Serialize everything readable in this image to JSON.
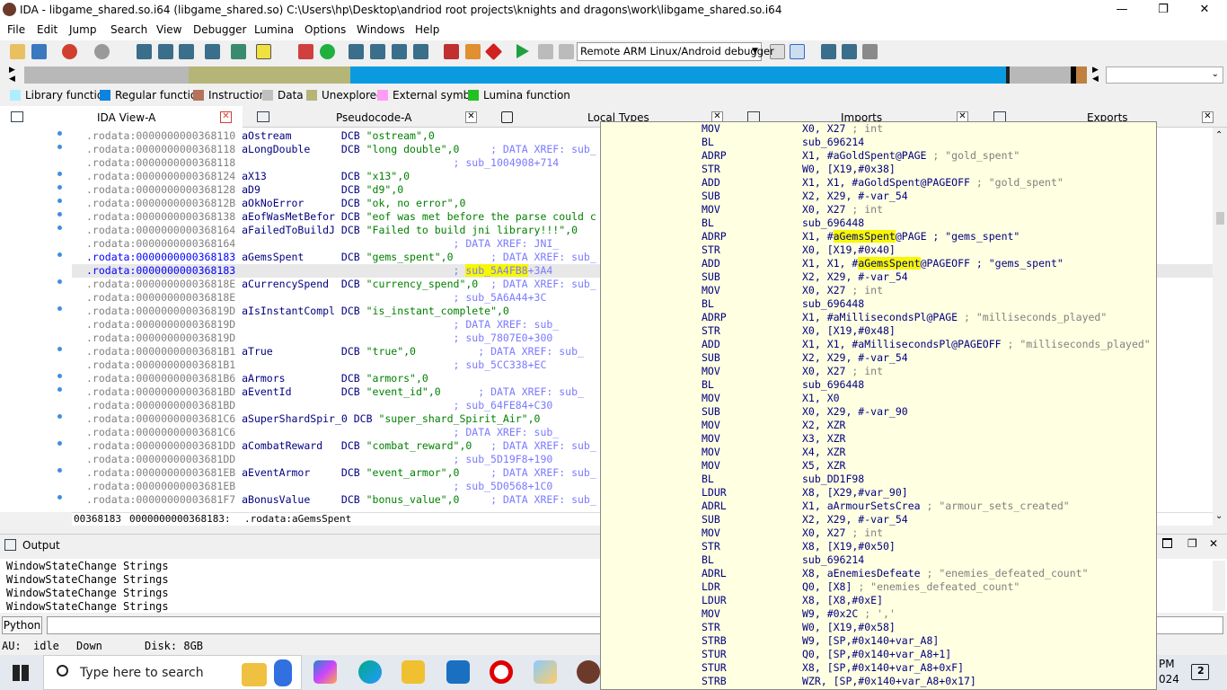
{
  "window": {
    "title": "IDA - libgame_shared.so.i64 (libgame_shared.so) C:\\Users\\hp\\Desktop\\andriod root projects\\knights and dragons\\work\\libgame_shared.so.i64",
    "minimize": "—",
    "restore": "❐",
    "close": "✕"
  },
  "menu": [
    "File",
    "Edit",
    "Jump",
    "Search",
    "View",
    "Debugger",
    "Lumina",
    "Options",
    "Windows",
    "Help"
  ],
  "toolbar": {
    "debugger_select": "Remote ARM Linux/Android debugger"
  },
  "legend": [
    {
      "label": "Library function",
      "color": "#aeeeff"
    },
    {
      "label": "Regular function",
      "color": "#0a84e0"
    },
    {
      "label": "Instruction",
      "color": "#b5735a"
    },
    {
      "label": "Data",
      "color": "#c0c0c0"
    },
    {
      "label": "Unexplored",
      "color": "#b5b578"
    },
    {
      "label": "External symbol",
      "color": "#ff9cf6"
    },
    {
      "label": "Lumina function",
      "color": "#22c022"
    }
  ],
  "tabs": {
    "ida_view": "IDA View-A",
    "pseudocode": "Pseudocode-A",
    "local_types": "Local Types",
    "imports": "Imports",
    "exports": "Exports"
  },
  "listing": [
    {
      "addr": ".rodata:0000000000368110",
      "name": "aOstream        ",
      "op": "DCB ",
      "val": "\"ostream\",0",
      "cmt": ""
    },
    {
      "addr": ".rodata:0000000000368118",
      "name": "aLongDouble     ",
      "op": "DCB ",
      "val": "\"long double\",0",
      "cmt": "     ; DATA XREF: sub_"
    },
    {
      "addr": ".rodata:0000000000368118",
      "name": "",
      "op": "",
      "val": "",
      "cmt": "                                  ; sub_1004908+714"
    },
    {
      "addr": ".rodata:0000000000368124",
      "name": "aX13            ",
      "op": "DCB ",
      "val": "\"x13\",0",
      "cmt": ""
    },
    {
      "addr": ".rodata:0000000000368128",
      "name": "aD9             ",
      "op": "DCB ",
      "val": "\"d9\",0",
      "cmt": ""
    },
    {
      "addr": ".rodata:000000000036812B",
      "name": "aOkNoError      ",
      "op": "DCB ",
      "val": "\"ok, no error\",0",
      "cmt": ""
    },
    {
      "addr": ".rodata:0000000000368138",
      "name": "aEofWasMetBefor ",
      "op": "DCB ",
      "val": "\"eof was met before the parse could c",
      "cmt": ""
    },
    {
      "addr": ".rodata:0000000000368164",
      "name": "aFailedToBuildJ ",
      "op": "DCB ",
      "val": "\"Failed to build jni library!!!\",0",
      "cmt": ""
    },
    {
      "addr": ".rodata:0000000000368164",
      "name": "",
      "op": "",
      "val": "",
      "cmt": "                                  ; DATA XREF: JNI_"
    },
    {
      "addr": ".rodata:0000000000368183",
      "name": "aGemsSpent      ",
      "op": "DCB ",
      "val": "\"gems_spent\",0",
      "cmt": "      ; DATA XREF: sub_"
    },
    {
      "addr": ".rodata:0000000000368183",
      "name": "",
      "op": "",
      "val": "",
      "cmt": "                                  ; sub_5A4FB8+3A4"
    },
    {
      "addr": ".rodata:000000000036818E",
      "name": "aCurrencySpend  ",
      "op": "DCB ",
      "val": "\"currency_spend\",0",
      "cmt": "  ; DATA XREF: sub_"
    },
    {
      "addr": ".rodata:000000000036818E",
      "name": "",
      "op": "",
      "val": "",
      "cmt": "                                  ; sub_5A6A44+3C"
    },
    {
      "addr": ".rodata:000000000036819D",
      "name": "aIsInstantCompl ",
      "op": "DCB ",
      "val": "\"is_instant_complete\",0",
      "cmt": ""
    },
    {
      "addr": ".rodata:000000000036819D",
      "name": "",
      "op": "",
      "val": "",
      "cmt": "                                  ; DATA XREF: sub_"
    },
    {
      "addr": ".rodata:000000000036819D",
      "name": "",
      "op": "",
      "val": "",
      "cmt": "                                  ; sub_7807E0+300"
    },
    {
      "addr": ".rodata:00000000003681B1",
      "name": "aTrue           ",
      "op": "DCB ",
      "val": "\"true\",0",
      "cmt": "          ; DATA XREF: sub_"
    },
    {
      "addr": ".rodata:00000000003681B1",
      "name": "",
      "op": "",
      "val": "",
      "cmt": "                                  ; sub_5CC338+EC"
    },
    {
      "addr": ".rodata:00000000003681B6",
      "name": "aArmors         ",
      "op": "DCB ",
      "val": "\"armors\",0",
      "cmt": ""
    },
    {
      "addr": ".rodata:00000000003681BD",
      "name": "aEventId        ",
      "op": "DCB ",
      "val": "\"event_id\",0",
      "cmt": "      ; DATA XREF: sub_"
    },
    {
      "addr": ".rodata:00000000003681BD",
      "name": "",
      "op": "",
      "val": "",
      "cmt": "                                  ; sub_64FE84+C30"
    },
    {
      "addr": ".rodata:00000000003681C6",
      "name": "aSuperShardSpir_0 ",
      "op": "DCB ",
      "val": "\"super_shard_Spirit_Air\",0",
      "cmt": ""
    },
    {
      "addr": ".rodata:00000000003681C6",
      "name": "",
      "op": "",
      "val": "",
      "cmt": "                                  ; DATA XREF: sub_"
    },
    {
      "addr": ".rodata:00000000003681DD",
      "name": "aCombatReward   ",
      "op": "DCB ",
      "val": "\"combat_reward\",0",
      "cmt": "   ; DATA XREF: sub_"
    },
    {
      "addr": ".rodata:00000000003681DD",
      "name": "",
      "op": "",
      "val": "",
      "cmt": "                                  ; sub_5D19F8+190"
    },
    {
      "addr": ".rodata:00000000003681EB",
      "name": "aEventArmor     ",
      "op": "DCB ",
      "val": "\"event_armor\",0",
      "cmt": "     ; DATA XREF: sub_"
    },
    {
      "addr": ".rodata:00000000003681EB",
      "name": "",
      "op": "",
      "val": "",
      "cmt": "                                  ; sub_5D0568+1C0"
    },
    {
      "addr": ".rodata:00000000003681F7",
      "name": "aBonusValue     ",
      "op": "DCB ",
      "val": "\"bonus_value\",0",
      "cmt": "     ; DATA XREF: sub_"
    }
  ],
  "status_line": {
    "offset": "00368183",
    "addr": "0000000000368183:",
    "symbol": ".rodata:aGemsSpent"
  },
  "output": {
    "title": "Output",
    "lines": [
      "WindowStateChange Strings",
      "WindowStateChange Strings",
      "WindowStateChange Strings",
      "WindowStateChange Strings"
    ],
    "python": "Python"
  },
  "status": {
    "au": "AU:",
    "state": "idle",
    "dir": "Down",
    "disk": "Disk: 8GB"
  },
  "taskbar": {
    "search_placeholder": "Type here to search",
    "clock_time": "PM",
    "clock_date": "024",
    "notif_count": "2"
  },
  "popup": [
    {
      "m": "MOV",
      "o": "X0, X27 ; int"
    },
    {
      "m": "BL",
      "o": "sub_696214"
    },
    {
      "m": "ADRP",
      "o": "X1, #aGoldSpent@PAGE ; \"gold_spent\""
    },
    {
      "m": "STR",
      "o": "W0, [X19,#0x38]"
    },
    {
      "m": "ADD",
      "o": "X1, X1, #aGoldSpent@PAGEOFF ; \"gold_spent\""
    },
    {
      "m": "SUB",
      "o": "X2, X29, #-var_54"
    },
    {
      "m": "MOV",
      "o": "X0, X27 ; int"
    },
    {
      "m": "BL",
      "o": "sub_696448"
    },
    {
      "m": "ADRP",
      "o": "X1, #aGemsSpent@PAGE ; \"gems_spent\""
    },
    {
      "m": "STR",
      "o": "X0, [X19,#0x40]"
    },
    {
      "m": "ADD",
      "o": "X1, X1, #aGemsSpent@PAGEOFF ; \"gems_spent\""
    },
    {
      "m": "SUB",
      "o": "X2, X29, #-var_54"
    },
    {
      "m": "MOV",
      "o": "X0, X27 ; int"
    },
    {
      "m": "BL",
      "o": "sub_696448"
    },
    {
      "m": "ADRP",
      "o": "X1, #aMillisecondsPl@PAGE ; \"milliseconds_played\""
    },
    {
      "m": "STR",
      "o": "X0, [X19,#0x48]"
    },
    {
      "m": "ADD",
      "o": "X1, X1, #aMillisecondsPl@PAGEOFF ; \"milliseconds_played\""
    },
    {
      "m": "SUB",
      "o": "X2, X29, #-var_54"
    },
    {
      "m": "MOV",
      "o": "X0, X27 ; int"
    },
    {
      "m": "BL",
      "o": "sub_696448"
    },
    {
      "m": "MOV",
      "o": "X1, X0"
    },
    {
      "m": "SUB",
      "o": "X0, X29, #-var_90"
    },
    {
      "m": "MOV",
      "o": "X2, XZR"
    },
    {
      "m": "MOV",
      "o": "X3, XZR"
    },
    {
      "m": "MOV",
      "o": "X4, XZR"
    },
    {
      "m": "MOV",
      "o": "X5, XZR"
    },
    {
      "m": "BL",
      "o": "sub_DD1F98"
    },
    {
      "m": "LDUR",
      "o": "X8, [X29,#var_90]"
    },
    {
      "m": "ADRL",
      "o": "X1, aArmourSetsCrea ; \"armour_sets_created\""
    },
    {
      "m": "SUB",
      "o": "X2, X29, #-var_54"
    },
    {
      "m": "MOV",
      "o": "X0, X27 ; int"
    },
    {
      "m": "STR",
      "o": "X8, [X19,#0x50]"
    },
    {
      "m": "BL",
      "o": "sub_696214"
    },
    {
      "m": "ADRL",
      "o": "X8, aEnemiesDefeate ; \"enemies_defeated_count\""
    },
    {
      "m": "LDR",
      "o": "Q0, [X8] ; \"enemies_defeated_count\""
    },
    {
      "m": "LDUR",
      "o": "X8, [X8,#0xE]"
    },
    {
      "m": "MOV",
      "o": "W9, #0x2C ; ','"
    },
    {
      "m": "STR",
      "o": "W0, [X19,#0x58]"
    },
    {
      "m": "STRB",
      "o": "W9, [SP,#0x140+var_A8]"
    },
    {
      "m": "STUR",
      "o": "Q0, [SP,#0x140+var_A8+1]"
    },
    {
      "m": "STUR",
      "o": "X8, [SP,#0x140+var_A8+0xF]"
    },
    {
      "m": "STRB",
      "o": "WZR, [SP,#0x140+var_A8+0x17]"
    }
  ]
}
